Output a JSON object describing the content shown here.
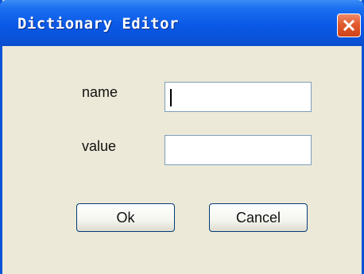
{
  "window": {
    "title": "Dictionary Editor"
  },
  "form": {
    "name_label": "name",
    "name_value": "",
    "value_label": "value",
    "value_value": ""
  },
  "buttons": {
    "ok_label": "Ok",
    "cancel_label": "Cancel"
  },
  "icons": {
    "close": "close-icon"
  },
  "colors": {
    "titlebar": "#0a58e6",
    "dialog_background": "#ece9d8",
    "close_button": "#e15a2e"
  }
}
